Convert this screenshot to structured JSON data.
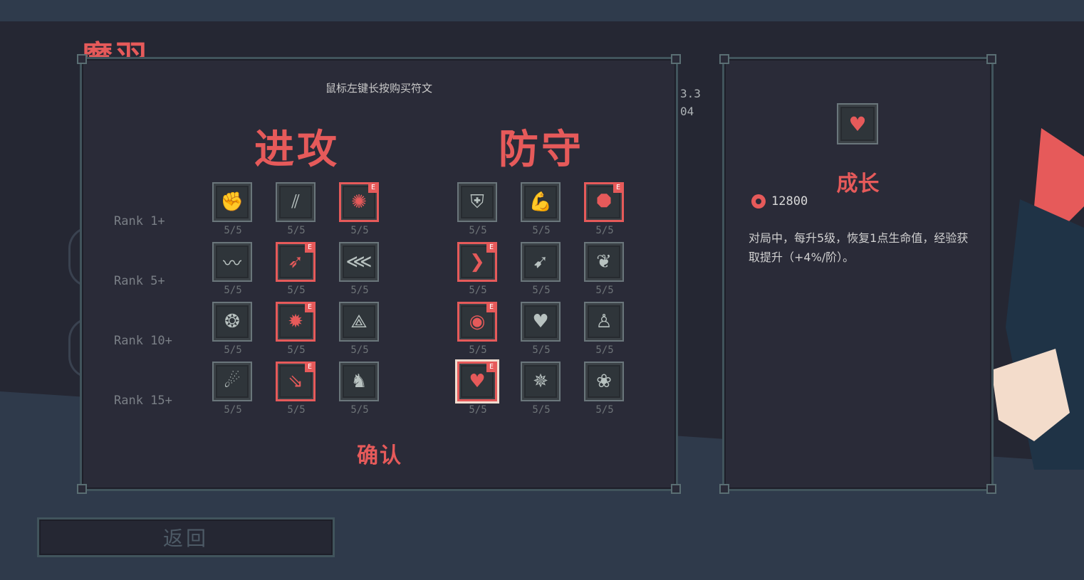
{
  "background": {
    "character_name": "魔羽"
  },
  "main": {
    "hint": "鼠标左键长按购买符文",
    "attack_title": "进攻",
    "defense_title": "防守",
    "confirm_label": "确认",
    "ranks": [
      "Rank 1+",
      "Rank 5+",
      "Rank 10+",
      "Rank 15+"
    ],
    "attack_runes": [
      {
        "count": "5/5",
        "icon": "fist-icon",
        "glyph": "✊",
        "selected": false
      },
      {
        "count": "5/5",
        "icon": "slash-icon",
        "glyph": "⫽",
        "selected": false
      },
      {
        "count": "5/5",
        "icon": "vortex-icon",
        "glyph": "✺",
        "selected": true,
        "badge": "E"
      },
      {
        "count": "5/5",
        "icon": "wind-arcs-icon",
        "glyph": "〰",
        "selected": false
      },
      {
        "count": "5/5",
        "icon": "claw-strike-icon",
        "glyph": "➶",
        "selected": true,
        "badge": "E"
      },
      {
        "count": "5/5",
        "icon": "burst-arrow-icon",
        "glyph": "⋘",
        "selected": false
      },
      {
        "count": "5/5",
        "icon": "bomb-icon",
        "glyph": "❂",
        "selected": false
      },
      {
        "count": "5/5",
        "icon": "explosion-icon",
        "glyph": "✹",
        "selected": true,
        "badge": "E"
      },
      {
        "count": "5/5",
        "icon": "triangle-orb-icon",
        "glyph": "⟁",
        "selected": false
      },
      {
        "count": "5/5",
        "icon": "comet-icon",
        "glyph": "☄",
        "selected": false
      },
      {
        "count": "5/5",
        "icon": "arrow-rain-icon",
        "glyph": "⇘",
        "selected": true,
        "badge": "E"
      },
      {
        "count": "5/5",
        "icon": "beast-icon",
        "glyph": "♞",
        "selected": false
      }
    ],
    "defense_runes": [
      {
        "count": "5/5",
        "icon": "shield-icon",
        "glyph": "⛨",
        "selected": false
      },
      {
        "count": "5/5",
        "icon": "muscle-icon",
        "glyph": "💪",
        "selected": false
      },
      {
        "count": "5/5",
        "icon": "octagon-ward-icon",
        "glyph": "⯃",
        "selected": true,
        "badge": "E"
      },
      {
        "count": "5/5",
        "icon": "boot-icon",
        "glyph": "❯",
        "selected": true,
        "badge": "E"
      },
      {
        "count": "5/5",
        "icon": "dash-icon",
        "glyph": "➹",
        "selected": false
      },
      {
        "count": "5/5",
        "icon": "flame-drop-icon",
        "glyph": "❦",
        "selected": false
      },
      {
        "count": "5/5",
        "icon": "circle-guard-icon",
        "glyph": "◉",
        "selected": true,
        "badge": "E"
      },
      {
        "count": "5/5",
        "icon": "hearts-icon",
        "glyph": "♥",
        "selected": false
      },
      {
        "count": "5/5",
        "icon": "figure-icon",
        "glyph": "♙",
        "selected": false
      },
      {
        "count": "5/5",
        "icon": "holy-heart-icon",
        "glyph": "♥",
        "selected": true,
        "badge": "E",
        "focused": true
      },
      {
        "count": "5/5",
        "icon": "angel-icon",
        "glyph": "✵",
        "selected": false
      },
      {
        "count": "5/5",
        "icon": "phoenix-icon",
        "glyph": "❀",
        "selected": false
      }
    ]
  },
  "stats": {
    "line1": "3.3",
    "line2": "04"
  },
  "info": {
    "icon": "holy-heart-icon",
    "name": "成长",
    "cost": "12800",
    "description": "对局中，每升5级，恢复1点生命值，经验获取提升（+4%/阶）。"
  },
  "back_label": "返回",
  "colors": {
    "accent": "#e65a5a",
    "panel": "#2a2b38",
    "border": "#41545c",
    "background": "#252733"
  }
}
